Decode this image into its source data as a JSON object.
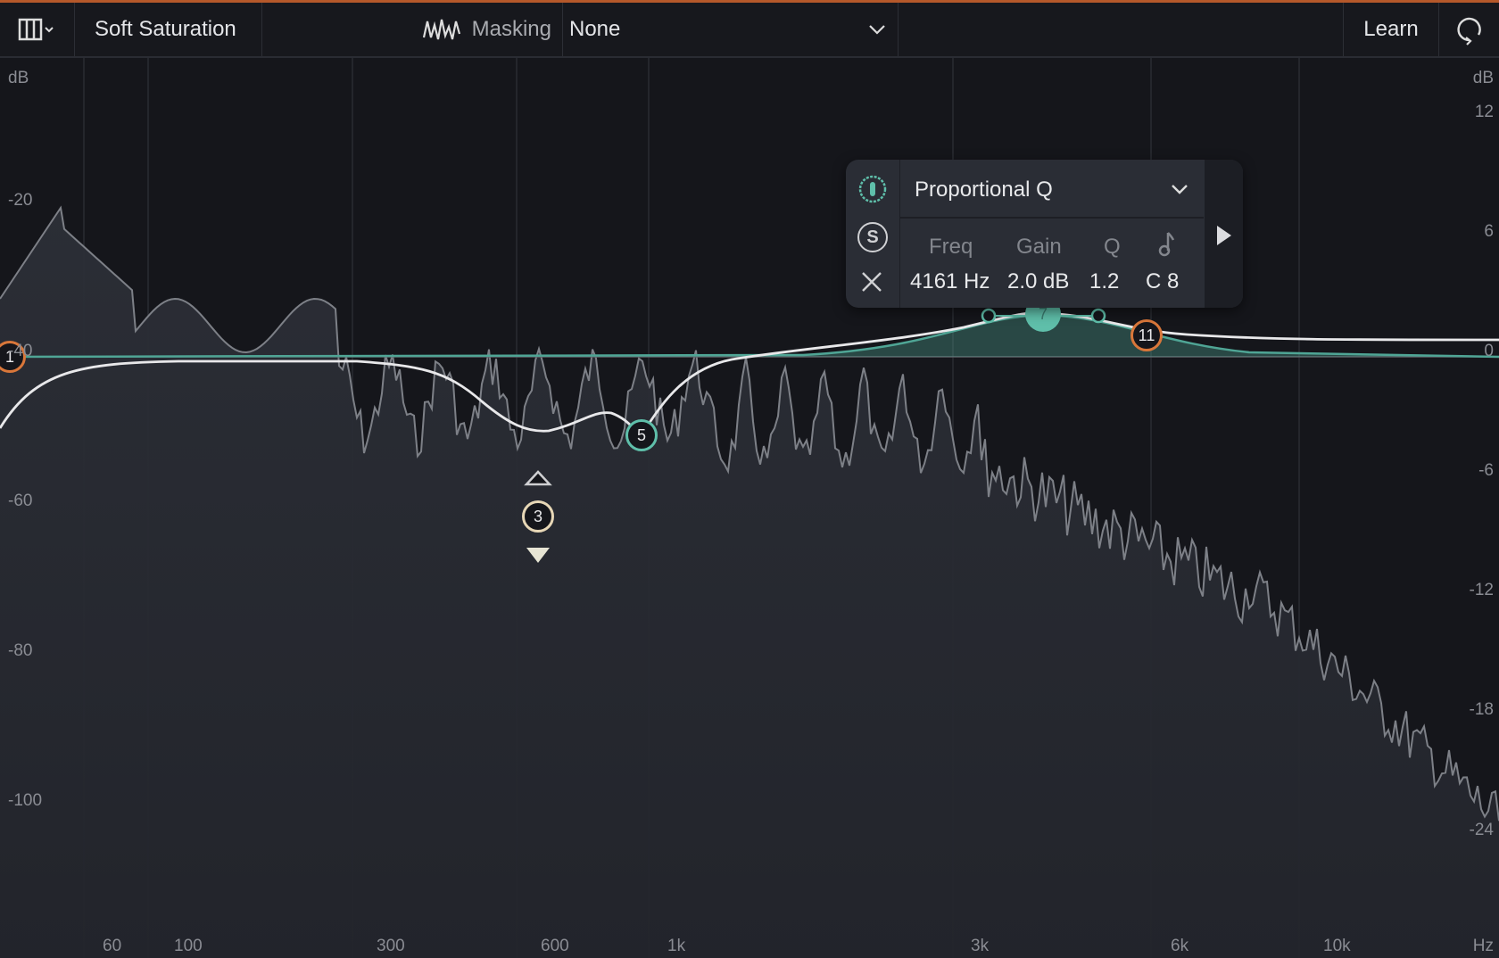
{
  "toolbar": {
    "layout_icon": "columns-icon",
    "mode_label": "Soft Saturation",
    "masking_icon": "waveform-icon",
    "masking_label": "Masking",
    "masking_value": "None",
    "learn_label": "Learn",
    "refresh_icon": "refresh-icon"
  },
  "axis": {
    "left_unit": "dB",
    "left_ticks": [
      "-20",
      "-40",
      "-60",
      "-80",
      "-100"
    ],
    "right_unit": "dB",
    "right_ticks": [
      "12",
      "6",
      "0",
      "-6",
      "-12",
      "-18",
      "-24"
    ],
    "freq_ticks": [
      "60",
      "100",
      "300",
      "600",
      "1k",
      "3k",
      "6k",
      "10k"
    ],
    "freq_unit": "Hz"
  },
  "bands": [
    {
      "id": "1",
      "color": "#d9773a"
    },
    {
      "id": "3",
      "color": "#e7d7b6"
    },
    {
      "id": "5",
      "color": "#5fbfaa"
    },
    {
      "id": "7",
      "color": "#5fbfaa"
    },
    {
      "id": "11",
      "color": "#d9773a"
    }
  ],
  "popup": {
    "shape": "Proportional Q",
    "power_icon": "power-icon",
    "solo_label": "S",
    "close_icon": "close-icon",
    "headers": {
      "freq": "Freq",
      "gain": "Gain",
      "q": "Q",
      "note_icon": "music-note-icon"
    },
    "values": {
      "freq": "4161 Hz",
      "gain": "2.0 dB",
      "q": "1.2",
      "note": "C 8"
    }
  },
  "colors": {
    "accent": "#5fbfaa",
    "orange": "#d9773a",
    "background": "#15161b"
  }
}
